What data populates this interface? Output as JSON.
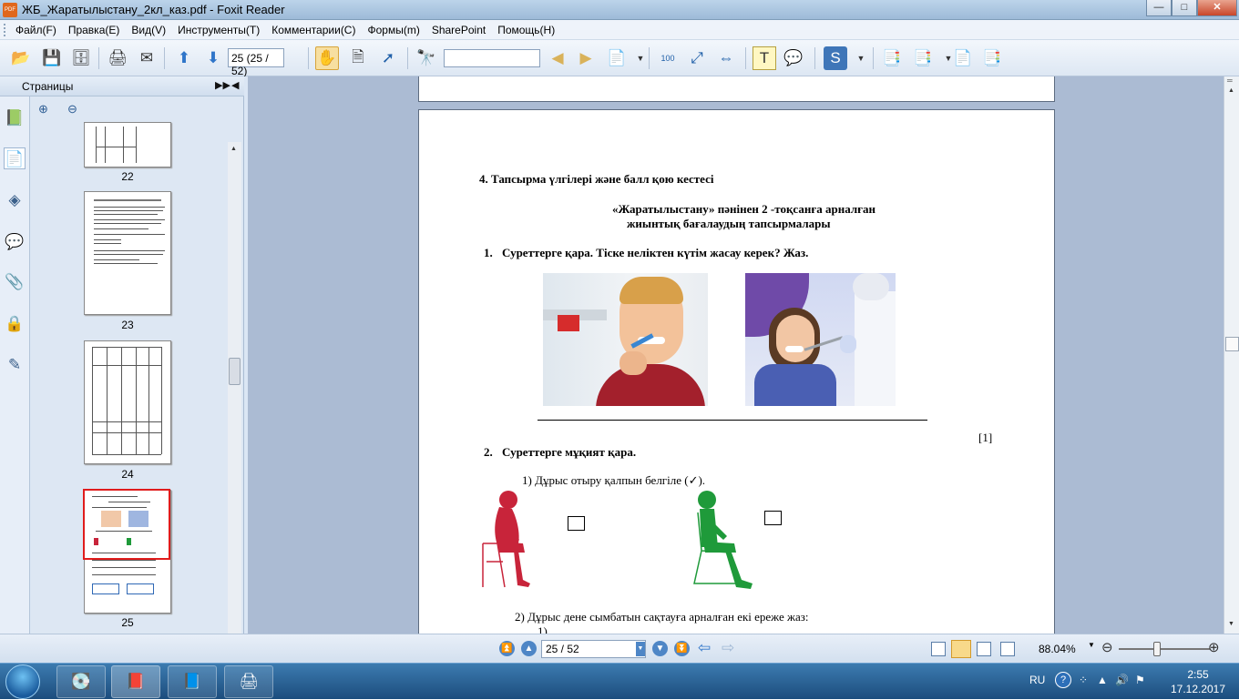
{
  "window": {
    "title": "ЖБ_Жаратылыстану_2кл_каз.pdf - Foxit Reader",
    "app_icon_text": "PDF",
    "minimize": "—",
    "maximize": "□",
    "close": "✕"
  },
  "menu": {
    "items": [
      "Файл(F)",
      "Правка(E)",
      "Вид(V)",
      "Инструменты(T)",
      "Комментарии(C)",
      "Формы(m)",
      "SharePoint",
      "Помощь(H)"
    ]
  },
  "toolbar": {
    "page_field": "25 (25 / 52)",
    "find_placeholder": ""
  },
  "sidebar": {
    "panel_title": "Страницы",
    "thumbnails": [
      {
        "label": "22"
      },
      {
        "label": "23"
      },
      {
        "label": "24"
      },
      {
        "label": "25"
      }
    ]
  },
  "document": {
    "section_title": "4. Тапсырма үлгілері және балл қою кестесі",
    "subtitle_line1": "«Жаратылыстану» пәнінен  2 -тоқсанға арналған",
    "subtitle_line2": "жиынтық бағалаудың тапсырмалары",
    "q1_number": "1.",
    "q1_text": "Суреттерге қара.  Тіске неліктен күтім жасау керек? Жаз.",
    "q1_score": "[1]",
    "q2_number": "2.",
    "q2_text": "Суреттерге мұқият қара.",
    "q2_sub1": "1) Дұрыс отыру қалпын  белгіле (✓).",
    "q2_sub2": "2) Дұрыс дене сымбатын сақтауға арналған екі ереже жаз:",
    "q2_sub2_item1": "1)"
  },
  "statusbar": {
    "page_nav": "25 / 52",
    "zoom": "88.04%"
  },
  "taskbar": {
    "language": "RU",
    "help": "?",
    "time": "2:55",
    "date": "17.12.2017"
  },
  "colors": {
    "accent": "#4e86c6",
    "selection_red": "#e01c1c",
    "figure_red": "#c8243a",
    "figure_green": "#1f9a3a"
  }
}
